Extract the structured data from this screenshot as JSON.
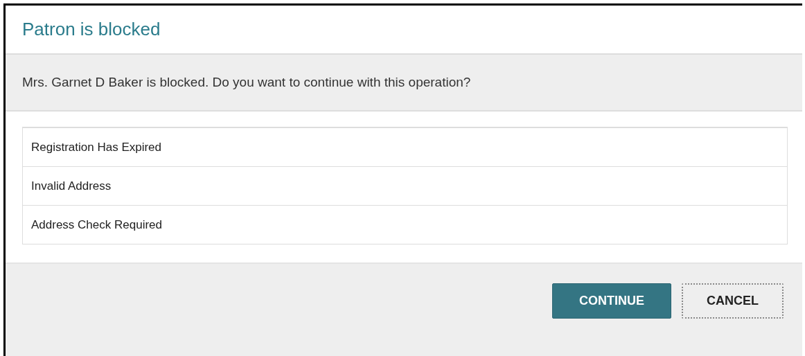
{
  "dialog": {
    "title": "Patron is blocked",
    "message": "Mrs. Garnet D Baker is blocked. Do you want to continue with this operation?",
    "reasons": [
      "Registration Has Expired",
      "Invalid Address",
      "Address Check Required"
    ],
    "buttons": [
      {
        "label": "CONTINUE",
        "kind": "primary"
      },
      {
        "label": "CANCEL",
        "kind": "secondary"
      }
    ]
  }
}
